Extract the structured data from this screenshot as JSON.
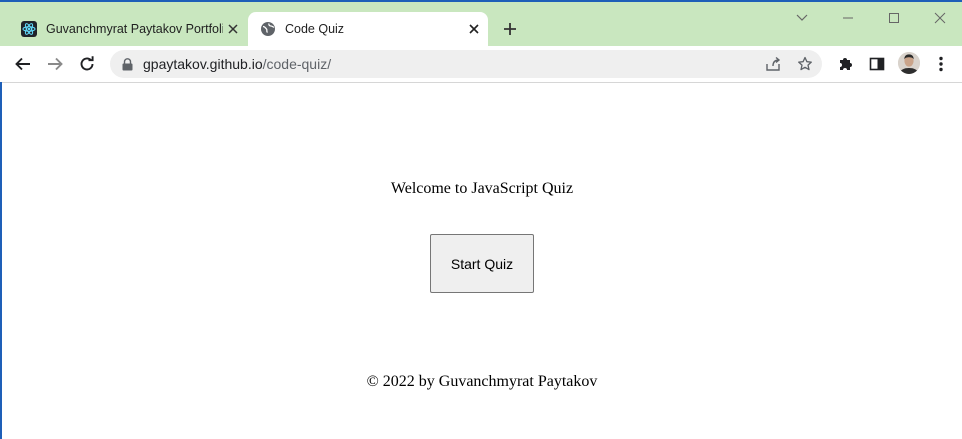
{
  "browser": {
    "tabs": [
      {
        "title": "Guvanchmyrat Paytakov Portfolio",
        "favicon": "react-icon",
        "active": false
      },
      {
        "title": "Code Quiz",
        "favicon": "globe-icon",
        "active": true
      }
    ],
    "address": {
      "host": "gpaytakov.github.io",
      "path": "/code-quiz/"
    },
    "colors": {
      "frame": "#c9e7bf",
      "accent_edge": "#1e5fb8"
    }
  },
  "page": {
    "welcome_text": "Welcome to JavaScript Quiz",
    "start_button_label": "Start Quiz",
    "footer_text": "© 2022 by Guvanchmyrat Paytakov"
  }
}
